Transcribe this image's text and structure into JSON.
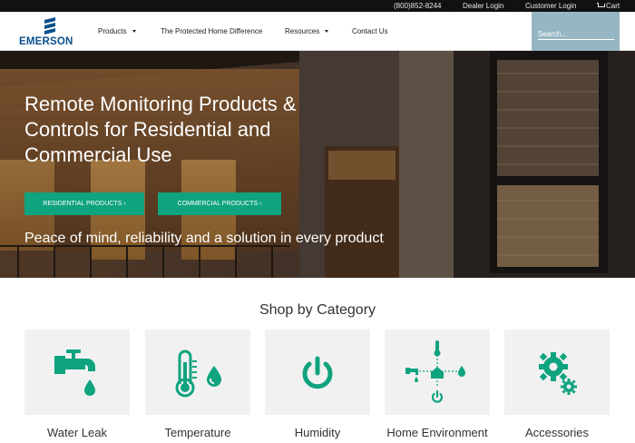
{
  "topbar": {
    "phone": "(800)852-8244",
    "dealer_login": "Dealer Login",
    "customer_login": "Customer Login",
    "cart": "Cart",
    "cart_icon": "cart-icon"
  },
  "nav": {
    "logo_text": "EMERSON",
    "items": [
      {
        "label": "Products",
        "has_dropdown": true
      },
      {
        "label": "The Protected Home Difference",
        "has_dropdown": false
      },
      {
        "label": "Resources",
        "has_dropdown": true
      },
      {
        "label": "Contact Us",
        "has_dropdown": false
      }
    ],
    "search_placeholder": "Search..."
  },
  "hero": {
    "title": "Remote Monitoring Products & Controls for Residential and Commercial Use",
    "buttons": [
      {
        "label": "RESIDENTIAL PRODUCTS  ›"
      },
      {
        "label": "COMMERCIAL PRODUCTS  ›"
      }
    ],
    "tagline": "Peace of mind, reliability and a solution in every product"
  },
  "categories": {
    "title": "Shop by Category",
    "items": [
      {
        "label": "Water Leak",
        "icon": "faucet-drop-icon"
      },
      {
        "label": "Temperature",
        "icon": "thermometer-drop-icon"
      },
      {
        "label": "Humidity",
        "icon": "power-icon"
      },
      {
        "label": "Home Environment",
        "icon": "home-environment-icon"
      },
      {
        "label": "Accessories",
        "icon": "gears-icon"
      }
    ]
  },
  "colors": {
    "accent_green": "#10a37f",
    "logo_blue": "#0a4f8c",
    "search_bg": "#97b6c4",
    "topbar_bg": "#111111"
  }
}
